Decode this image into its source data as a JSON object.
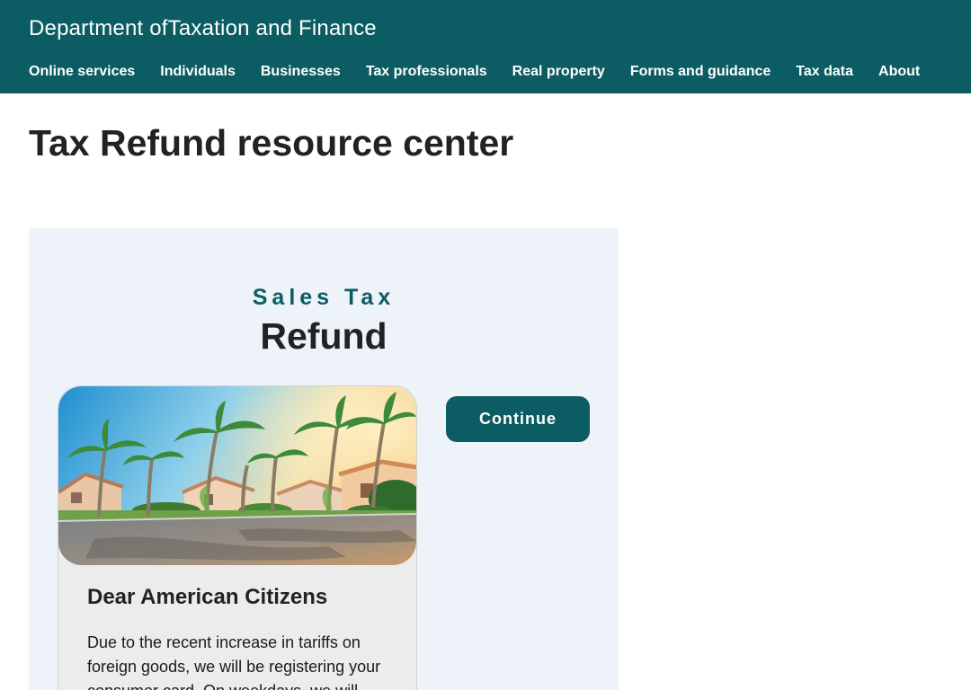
{
  "header": {
    "department_title": "Department ofTaxation and Finance",
    "nav": [
      {
        "label": "Online services"
      },
      {
        "label": "Individuals"
      },
      {
        "label": "Businesses"
      },
      {
        "label": "Tax professionals"
      },
      {
        "label": "Real property"
      },
      {
        "label": "Forms and guidance"
      },
      {
        "label": "Tax data"
      },
      {
        "label": "About"
      }
    ]
  },
  "page": {
    "title": "Tax Refund resource center"
  },
  "panel": {
    "eyebrow": "Sales Tax",
    "heading": "Refund",
    "continue_label": "Continue",
    "card": {
      "heading": "Dear American Citizens",
      "body": "Due to the recent increase in tariffs on foreign goods, we will be registering your consumer card. On weekdays, we will"
    }
  },
  "colors": {
    "brand": "#0b5c63",
    "panel_bg": "#eef3f9",
    "card_bg": "#ececec"
  }
}
